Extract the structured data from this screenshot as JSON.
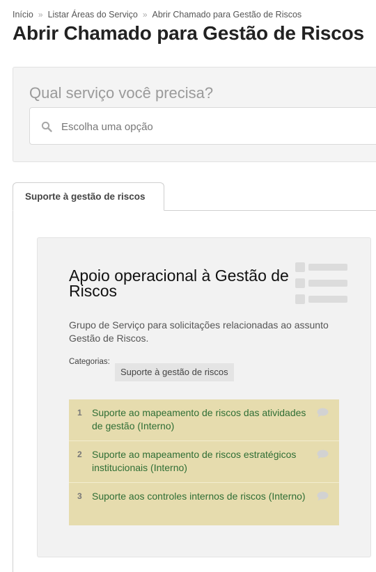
{
  "breadcrumb": {
    "items": [
      "Início",
      "Listar Áreas do Serviço",
      "Abrir Chamado para Gestão de Riscos"
    ],
    "separator": "»"
  },
  "page": {
    "title": "Abrir Chamado para Gestão de Riscos"
  },
  "search": {
    "heading": "Qual serviço você precisa?",
    "placeholder": "Escolha uma opção",
    "value": "",
    "icon": "search-icon"
  },
  "tabs": [
    {
      "label": "Suporte à gestão de riscos",
      "active": true
    }
  ],
  "service_group": {
    "title": "Apoio operacional à Gestão de Riscos",
    "description": "Grupo de Serviço para solicitações relacionadas ao assunto Gestão de Riscos.",
    "categories_label": "Categorias:",
    "categories": [
      "Suporte à gestão de riscos"
    ],
    "icon": "list-icon",
    "services": [
      {
        "number": "1",
        "label": "Suporte ao mapeamento de riscos das atividades de gestão (Interno)",
        "icon": "chat-icon"
      },
      {
        "number": "2",
        "label": "Suporte ao mapeamento de riscos estratégicos institucionais (Interno)",
        "icon": "chat-icon"
      },
      {
        "number": "3",
        "label": "Suporte aos controles internos de riscos (Interno)",
        "icon": "chat-icon"
      }
    ]
  },
  "colors": {
    "service_row_bg": "#e6dcae",
    "service_link": "#2f6e35",
    "panel_bg": "#f4f4f4",
    "card_bg": "#f2f2f2"
  }
}
